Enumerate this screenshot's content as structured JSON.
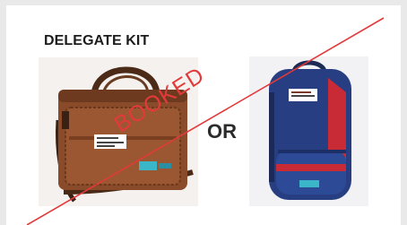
{
  "heading": "DELEGATE KIT",
  "separator": "OR",
  "stamp": {
    "text": "BOOKED",
    "color": "#e23a3a"
  },
  "items": [
    {
      "name": "laptop-bag",
      "icon": "brown-leather-laptop-bag"
    },
    {
      "name": "backpack",
      "icon": "navy-red-backpack"
    }
  ]
}
